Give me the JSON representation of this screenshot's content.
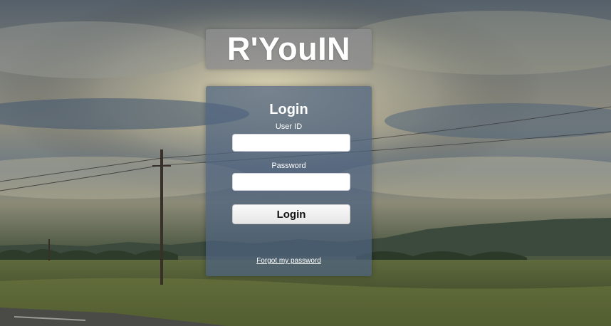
{
  "brand": {
    "title": "R'YouIN"
  },
  "login_form": {
    "title": "Login",
    "user_id_label": "User ID",
    "user_id_value": "",
    "password_label": "Password",
    "password_value": "",
    "submit_label": "Login",
    "forgot_label": "Forgot my password"
  },
  "colors": {
    "panel_bg": "#4e6280",
    "brand_bg": "#8c8c8e",
    "text": "#ffffff",
    "button_text": "#111111"
  }
}
